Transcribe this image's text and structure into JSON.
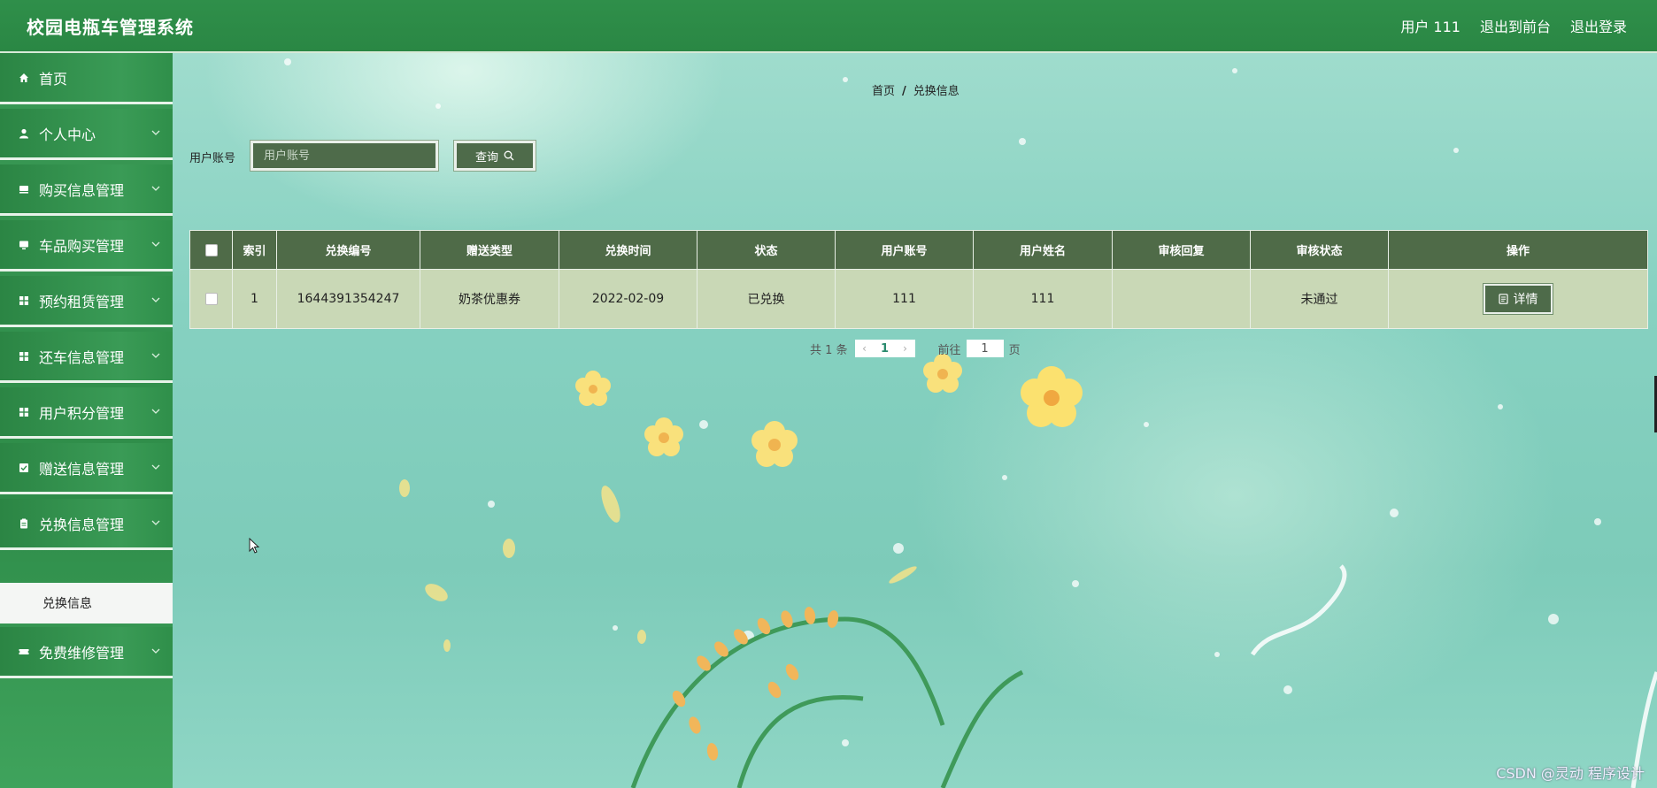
{
  "header": {
    "title": "校园电瓶车管理系统",
    "user": "用户 111",
    "back_to_front": "退出到前台",
    "logout": "退出登录"
  },
  "sidebar": {
    "items": [
      {
        "label": "首页",
        "icon": "home-icon"
      },
      {
        "label": "个人中心",
        "icon": "user-icon"
      },
      {
        "label": "购买信息管理",
        "icon": "menu-icon"
      },
      {
        "label": "车品购买管理",
        "icon": "monitor-icon"
      },
      {
        "label": "预约租赁管理",
        "icon": "grid-icon"
      },
      {
        "label": "还车信息管理",
        "icon": "grid-icon"
      },
      {
        "label": "用户积分管理",
        "icon": "grid-icon"
      },
      {
        "label": "赠送信息管理",
        "icon": "checkbox-icon"
      },
      {
        "label": "兑换信息管理",
        "icon": "clipboard-icon"
      },
      {
        "label": "免费维修管理",
        "icon": "ticket-icon"
      }
    ],
    "submenu": {
      "label": "兑换信息"
    }
  },
  "breadcrumb": {
    "home": "首页",
    "current": "兑换信息"
  },
  "search": {
    "label": "用户账号",
    "placeholder": "用户账号",
    "button_label": "查询"
  },
  "table": {
    "headers": [
      "索引",
      "兑换编号",
      "赠送类型",
      "兑换时间",
      "状态",
      "用户账号",
      "用户姓名",
      "审核回复",
      "审核状态",
      "操作"
    ],
    "rows": [
      {
        "index": "1",
        "exchange_no": "1644391354247",
        "gift_type": "奶茶优惠券",
        "exchange_time": "2022-02-09",
        "status": "已兑换",
        "account": "111",
        "name": "111",
        "reply": "",
        "review_status": "未通过",
        "action_label": "详情"
      }
    ]
  },
  "pagination": {
    "total_text": "共 1 条",
    "current_page": "1",
    "goto_label": "前往",
    "goto_value": "1",
    "page_suffix": "页"
  },
  "watermark": "CSDN @灵动 程序设计",
  "colors": {
    "header_green": "#2f8f4a",
    "table_header": "#4f6b48",
    "table_row": "#c9d8b6",
    "button_dark": "#4e6b4a"
  }
}
